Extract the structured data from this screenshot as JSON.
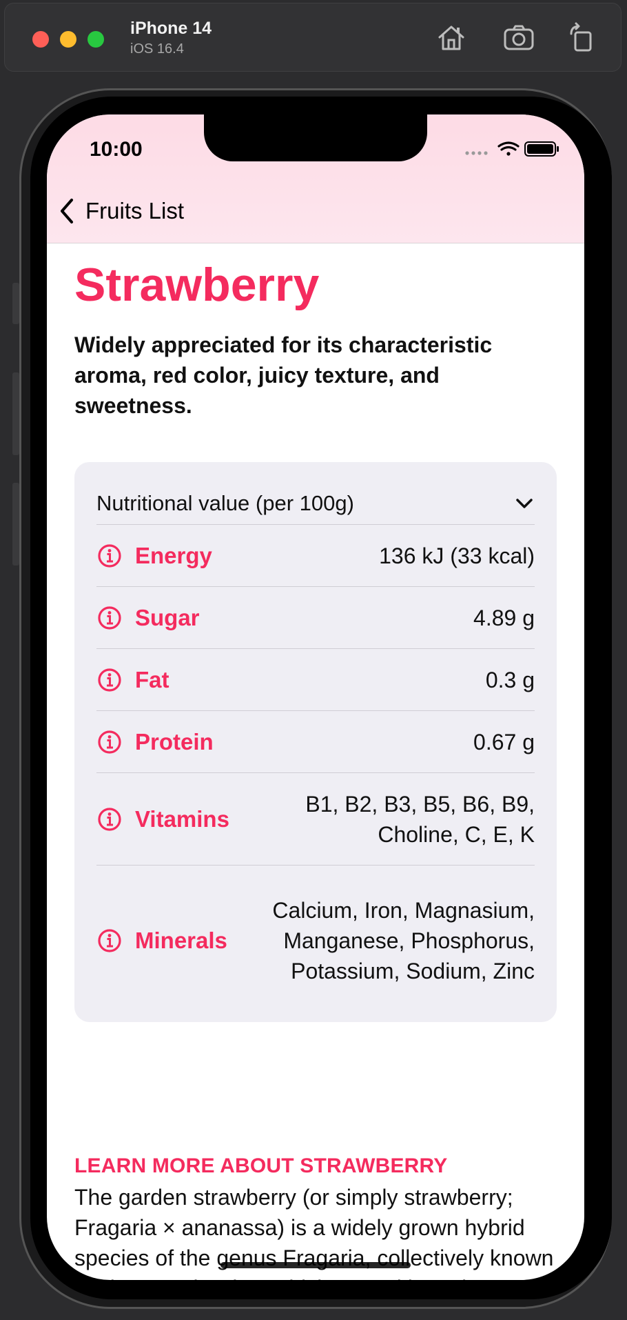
{
  "simulator": {
    "device_name": "iPhone 14",
    "os_version": "iOS 16.4",
    "toolbar_icons": [
      "home-icon",
      "screenshot-icon",
      "rotate-icon"
    ]
  },
  "status_bar": {
    "time": "10:00"
  },
  "nav": {
    "back_label": "Fruits List"
  },
  "fruit": {
    "title": "Strawberry",
    "headline": "Widely appreciated for its characteristic aroma,  red color, juicy texture, and sweetness.",
    "nutrition_header": "Nutritional value (per 100g)",
    "nutrients": [
      {
        "label": "Energy",
        "value": "136 kJ (33 kcal)"
      },
      {
        "label": "Sugar",
        "value": "4.89 g"
      },
      {
        "label": "Fat",
        "value": "0.3 g"
      },
      {
        "label": "Protein",
        "value": "0.67 g"
      },
      {
        "label": "Vitamins",
        "value": "B1, B2, B3, B5, B6, B9, Choline, C, E, K"
      },
      {
        "label": "Minerals",
        "value": "Calcium, Iron, Magnasium, Manganese, Phosphorus, Potassium, Sodium, Zinc"
      }
    ],
    "learn_more": "LEARN MORE ABOUT STRAWBERRY",
    "description": "The garden strawberry (or simply strawberry; Fragaria × ananassa) is a widely grown hybrid species of the genus Fragaria, collectively known as the strawberries, which are cultivated worldwide for their fruit. The fruit is widely appreciated for its characteristic"
  },
  "colors": {
    "accent": "#f42b5e",
    "card_background": "#efeef4",
    "nav_background": "#fddbe5"
  }
}
